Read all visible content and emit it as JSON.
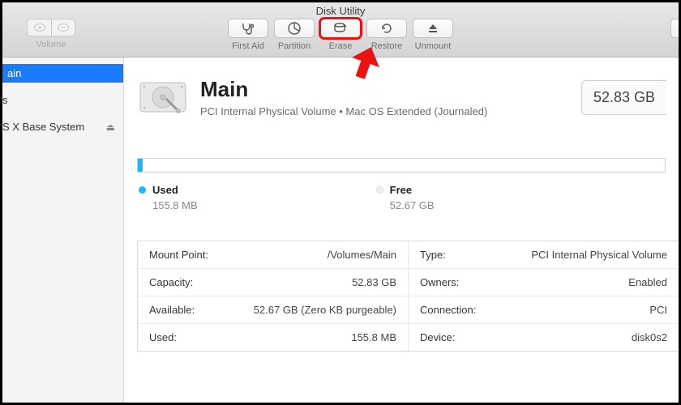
{
  "window": {
    "title": "Disk Utility"
  },
  "toolbar": {
    "volume_label": "Volume",
    "buttons": {
      "first_aid": "First Aid",
      "partition": "Partition",
      "erase": "Erase",
      "restore": "Restore",
      "unmount": "Unmount"
    }
  },
  "sidebar": {
    "items": [
      {
        "label": "ain",
        "selected": true
      },
      {
        "label": "s"
      },
      {
        "label": "S X Base System",
        "ejectable": true
      }
    ]
  },
  "volume": {
    "name": "Main",
    "subtitle": "PCI Internal Physical Volume • Mac OS Extended (Journaled)",
    "capacity_display": "52.83 GB"
  },
  "usage": {
    "used_label": "Used",
    "used_value": "155.8 MB",
    "free_label": "Free",
    "free_value": "52.67 GB"
  },
  "details": {
    "left": [
      {
        "k": "Mount Point:",
        "v": "/Volumes/Main"
      },
      {
        "k": "Capacity:",
        "v": "52.83 GB"
      },
      {
        "k": "Available:",
        "v": "52.67 GB (Zero KB purgeable)"
      },
      {
        "k": "Used:",
        "v": "155.8 MB"
      }
    ],
    "right": [
      {
        "k": "Type:",
        "v": "PCI Internal Physical Volume"
      },
      {
        "k": "Owners:",
        "v": "Enabled"
      },
      {
        "k": "Connection:",
        "v": "PCI"
      },
      {
        "k": "Device:",
        "v": "disk0s2"
      }
    ]
  },
  "annotation": {
    "highlight_button": "erase"
  }
}
